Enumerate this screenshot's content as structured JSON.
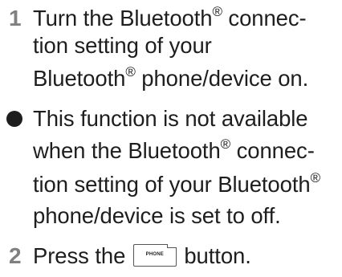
{
  "step1": {
    "number": "1",
    "line1_a": "Turn the Bluetooth",
    "line1_reg": "®",
    "line1_b": " connec-",
    "line2": "tion setting of your",
    "line3_a": "Bluetooth",
    "line3_reg": "®",
    "line3_b": " phone/device on."
  },
  "note": {
    "bullet_icon": "filled-circle",
    "line1": "This function is not available",
    "line2_a": "when the Bluetooth",
    "line2_reg": "®",
    "line2_b": " connec-",
    "line3_a": "tion setting of your Bluetooth",
    "line3_reg": "®",
    "line4": "phone/device is set to off."
  },
  "step2": {
    "number": "2",
    "text_a": "Press the ",
    "button_icon_label": "PHONE",
    "text_b": " button."
  },
  "colors": {
    "text": "#1e1e1e",
    "step_number": "#808080"
  }
}
